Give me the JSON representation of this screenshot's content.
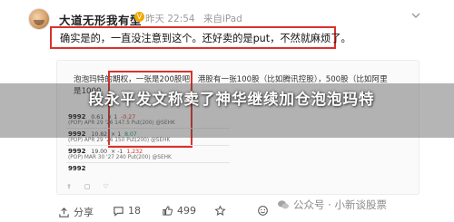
{
  "post": {
    "username": "大道无形我有型",
    "verified_badge": "V",
    "time": "昨天 22:54",
    "source": "来自iPad",
    "comment": "确实是的，一直没注意到这个。还好卖的是put，不然就麻烦了。"
  },
  "embed": {
    "line1": "泡泡玛特的期权，一张是200股吧，港股有一张100股（比如腾讯控股），500股（比如阿里",
    "line2": "是1000",
    "trades": [
      {
        "code": "9992",
        "price": "0.61",
        "mult": "× 1",
        "pnl": "-0.27",
        "pnl_color": "#d9322b",
        "sub": "(POP) APR 29 '26 147.5 Put(200) @SEHK"
      },
      {
        "code": "9992",
        "price": "10.82",
        "mult": "× 1",
        "pnl": "8.07",
        "pnl_color": "#1f9d55",
        "sub": "(POP) APR 29 '26 150 Put(200) @SEHK"
      },
      {
        "code": "9992",
        "price": "19.00",
        "mult": "× -1",
        "pnl": "1,232",
        "pnl_color": "#d9322b",
        "sub": "(POP) MAR 30 '27 240 Put(200) @SEHK"
      },
      {
        "code": "9992",
        "price": "",
        "mult": "",
        "pnl": "",
        "pnl_color": "#444444",
        "sub": ""
      }
    ]
  },
  "headline": "段永平发文称卖了神华继续加仓泡泡玛特",
  "footer": {
    "share": "分享",
    "comment_count": "18",
    "like_count": "499"
  },
  "watermark": "公众号 · 小新谈股票",
  "colors": {
    "highlight": "#d9322b",
    "verified": "#f2a900"
  }
}
